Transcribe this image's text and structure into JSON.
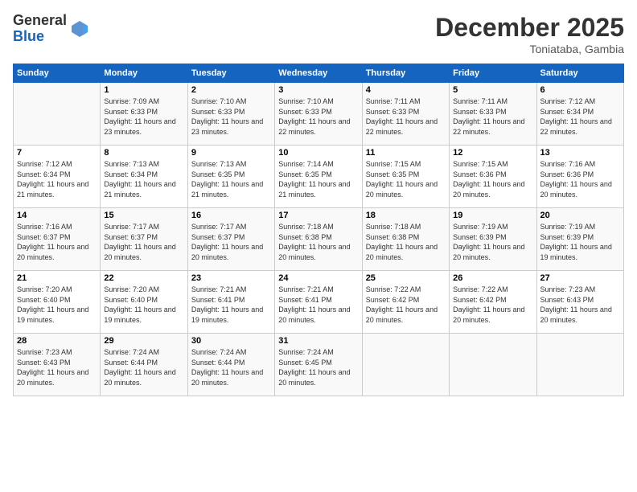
{
  "logo": {
    "general": "General",
    "blue": "Blue"
  },
  "header": {
    "month": "December 2025",
    "location": "Toniataba, Gambia"
  },
  "days_of_week": [
    "Sunday",
    "Monday",
    "Tuesday",
    "Wednesday",
    "Thursday",
    "Friday",
    "Saturday"
  ],
  "weeks": [
    [
      {
        "day": "",
        "sunrise": "",
        "sunset": "",
        "daylight": ""
      },
      {
        "day": "1",
        "sunrise": "Sunrise: 7:09 AM",
        "sunset": "Sunset: 6:33 PM",
        "daylight": "Daylight: 11 hours and 23 minutes."
      },
      {
        "day": "2",
        "sunrise": "Sunrise: 7:10 AM",
        "sunset": "Sunset: 6:33 PM",
        "daylight": "Daylight: 11 hours and 23 minutes."
      },
      {
        "day": "3",
        "sunrise": "Sunrise: 7:10 AM",
        "sunset": "Sunset: 6:33 PM",
        "daylight": "Daylight: 11 hours and 22 minutes."
      },
      {
        "day": "4",
        "sunrise": "Sunrise: 7:11 AM",
        "sunset": "Sunset: 6:33 PM",
        "daylight": "Daylight: 11 hours and 22 minutes."
      },
      {
        "day": "5",
        "sunrise": "Sunrise: 7:11 AM",
        "sunset": "Sunset: 6:33 PM",
        "daylight": "Daylight: 11 hours and 22 minutes."
      },
      {
        "day": "6",
        "sunrise": "Sunrise: 7:12 AM",
        "sunset": "Sunset: 6:34 PM",
        "daylight": "Daylight: 11 hours and 22 minutes."
      }
    ],
    [
      {
        "day": "7",
        "sunrise": "Sunrise: 7:12 AM",
        "sunset": "Sunset: 6:34 PM",
        "daylight": "Daylight: 11 hours and 21 minutes."
      },
      {
        "day": "8",
        "sunrise": "Sunrise: 7:13 AM",
        "sunset": "Sunset: 6:34 PM",
        "daylight": "Daylight: 11 hours and 21 minutes."
      },
      {
        "day": "9",
        "sunrise": "Sunrise: 7:13 AM",
        "sunset": "Sunset: 6:35 PM",
        "daylight": "Daylight: 11 hours and 21 minutes."
      },
      {
        "day": "10",
        "sunrise": "Sunrise: 7:14 AM",
        "sunset": "Sunset: 6:35 PM",
        "daylight": "Daylight: 11 hours and 21 minutes."
      },
      {
        "day": "11",
        "sunrise": "Sunrise: 7:15 AM",
        "sunset": "Sunset: 6:35 PM",
        "daylight": "Daylight: 11 hours and 20 minutes."
      },
      {
        "day": "12",
        "sunrise": "Sunrise: 7:15 AM",
        "sunset": "Sunset: 6:36 PM",
        "daylight": "Daylight: 11 hours and 20 minutes."
      },
      {
        "day": "13",
        "sunrise": "Sunrise: 7:16 AM",
        "sunset": "Sunset: 6:36 PM",
        "daylight": "Daylight: 11 hours and 20 minutes."
      }
    ],
    [
      {
        "day": "14",
        "sunrise": "Sunrise: 7:16 AM",
        "sunset": "Sunset: 6:37 PM",
        "daylight": "Daylight: 11 hours and 20 minutes."
      },
      {
        "day": "15",
        "sunrise": "Sunrise: 7:17 AM",
        "sunset": "Sunset: 6:37 PM",
        "daylight": "Daylight: 11 hours and 20 minutes."
      },
      {
        "day": "16",
        "sunrise": "Sunrise: 7:17 AM",
        "sunset": "Sunset: 6:37 PM",
        "daylight": "Daylight: 11 hours and 20 minutes."
      },
      {
        "day": "17",
        "sunrise": "Sunrise: 7:18 AM",
        "sunset": "Sunset: 6:38 PM",
        "daylight": "Daylight: 11 hours and 20 minutes."
      },
      {
        "day": "18",
        "sunrise": "Sunrise: 7:18 AM",
        "sunset": "Sunset: 6:38 PM",
        "daylight": "Daylight: 11 hours and 20 minutes."
      },
      {
        "day": "19",
        "sunrise": "Sunrise: 7:19 AM",
        "sunset": "Sunset: 6:39 PM",
        "daylight": "Daylight: 11 hours and 20 minutes."
      },
      {
        "day": "20",
        "sunrise": "Sunrise: 7:19 AM",
        "sunset": "Sunset: 6:39 PM",
        "daylight": "Daylight: 11 hours and 19 minutes."
      }
    ],
    [
      {
        "day": "21",
        "sunrise": "Sunrise: 7:20 AM",
        "sunset": "Sunset: 6:40 PM",
        "daylight": "Daylight: 11 hours and 19 minutes."
      },
      {
        "day": "22",
        "sunrise": "Sunrise: 7:20 AM",
        "sunset": "Sunset: 6:40 PM",
        "daylight": "Daylight: 11 hours and 19 minutes."
      },
      {
        "day": "23",
        "sunrise": "Sunrise: 7:21 AM",
        "sunset": "Sunset: 6:41 PM",
        "daylight": "Daylight: 11 hours and 19 minutes."
      },
      {
        "day": "24",
        "sunrise": "Sunrise: 7:21 AM",
        "sunset": "Sunset: 6:41 PM",
        "daylight": "Daylight: 11 hours and 20 minutes."
      },
      {
        "day": "25",
        "sunrise": "Sunrise: 7:22 AM",
        "sunset": "Sunset: 6:42 PM",
        "daylight": "Daylight: 11 hours and 20 minutes."
      },
      {
        "day": "26",
        "sunrise": "Sunrise: 7:22 AM",
        "sunset": "Sunset: 6:42 PM",
        "daylight": "Daylight: 11 hours and 20 minutes."
      },
      {
        "day": "27",
        "sunrise": "Sunrise: 7:23 AM",
        "sunset": "Sunset: 6:43 PM",
        "daylight": "Daylight: 11 hours and 20 minutes."
      }
    ],
    [
      {
        "day": "28",
        "sunrise": "Sunrise: 7:23 AM",
        "sunset": "Sunset: 6:43 PM",
        "daylight": "Daylight: 11 hours and 20 minutes."
      },
      {
        "day": "29",
        "sunrise": "Sunrise: 7:24 AM",
        "sunset": "Sunset: 6:44 PM",
        "daylight": "Daylight: 11 hours and 20 minutes."
      },
      {
        "day": "30",
        "sunrise": "Sunrise: 7:24 AM",
        "sunset": "Sunset: 6:44 PM",
        "daylight": "Daylight: 11 hours and 20 minutes."
      },
      {
        "day": "31",
        "sunrise": "Sunrise: 7:24 AM",
        "sunset": "Sunset: 6:45 PM",
        "daylight": "Daylight: 11 hours and 20 minutes."
      },
      {
        "day": "",
        "sunrise": "",
        "sunset": "",
        "daylight": ""
      },
      {
        "day": "",
        "sunrise": "",
        "sunset": "",
        "daylight": ""
      },
      {
        "day": "",
        "sunrise": "",
        "sunset": "",
        "daylight": ""
      }
    ]
  ]
}
